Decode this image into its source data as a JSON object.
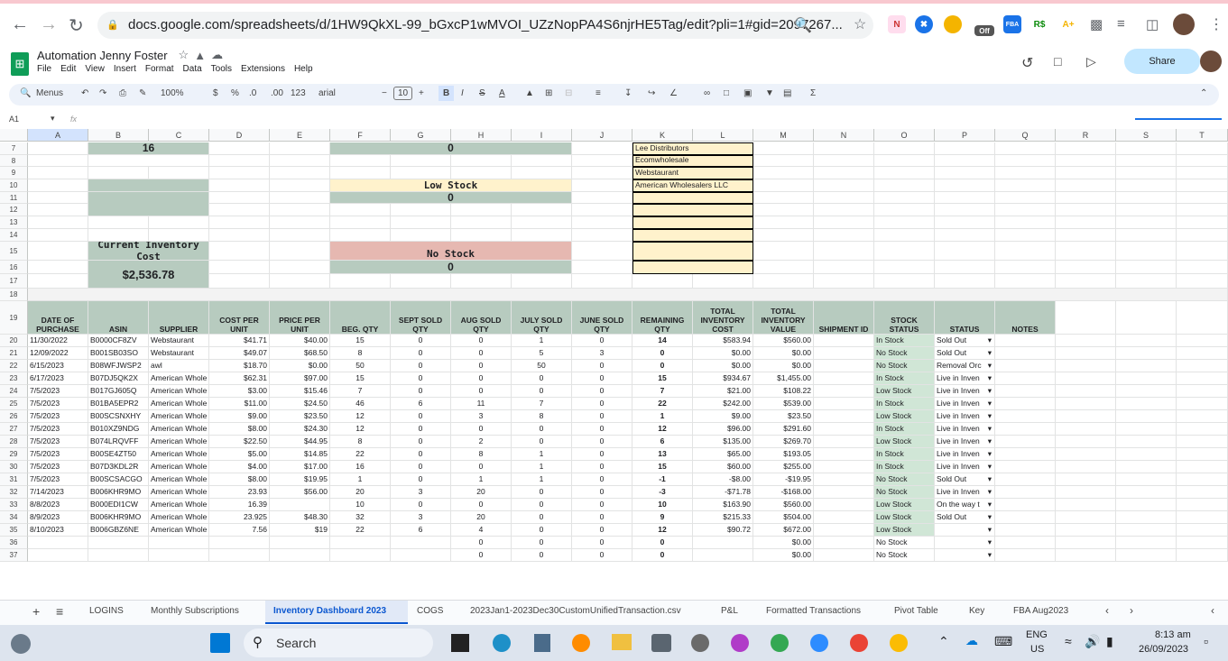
{
  "browser": {
    "url": "docs.google.com/spreadsheets/d/1HW9QkXL-99_bGxcP1wMVOI_UZzNopPA4S6njrHE5Tag/edit?pli=1#gid=2097267...",
    "ext_off": "Off"
  },
  "doc": {
    "title": "Automation Jenny Foster",
    "menus": [
      "File",
      "Edit",
      "View",
      "Insert",
      "Format",
      "Data",
      "Tools",
      "Extensions",
      "Help"
    ],
    "share": "Share"
  },
  "toolbar": {
    "menus": "Menus",
    "zoom": "100%",
    "currency": "$",
    "percent": "%",
    "dec_dec": ".0",
    "dec_inc": ".00",
    "fmt123": "123",
    "font": "arial",
    "size": "10"
  },
  "formula": {
    "cellref": "A1",
    "fx": "fx"
  },
  "columns": [
    "A",
    "B",
    "C",
    "D",
    "E",
    "F",
    "G",
    "H",
    "I",
    "J",
    "K",
    "L",
    "M",
    "N",
    "O",
    "P",
    "Q",
    "R",
    "S",
    "T"
  ],
  "rownums": [
    "7",
    "8",
    "9",
    "10",
    "11",
    "12",
    "13",
    "14",
    "15",
    "16",
    "17",
    "18",
    "19",
    "20",
    "21",
    "22",
    "23",
    "24",
    "25",
    "26",
    "27",
    "28",
    "29",
    "30",
    "31",
    "32",
    "33",
    "34",
    "35",
    "36",
    "37"
  ],
  "dashboard": {
    "val16": "16",
    "val0a": "0",
    "low_stock": "Low Stock",
    "val0b": "0",
    "inv_cost_label": "Current Inventory Cost",
    "inv_cost": "$2,536.78",
    "no_stock": "No Stock",
    "val0c": "0",
    "suppliers": [
      "Lee Distributors",
      "Ecomwholesale",
      "Webstaurant",
      "American Wholesalers LLC"
    ]
  },
  "table": {
    "headers": [
      "DATE OF PURCHASE",
      "ASIN",
      "SUPPLIER",
      "COST PER UNIT",
      "PRICE PER UNIT",
      "BEG. QTY",
      "SEPT SOLD QTY",
      "AUG SOLD QTY",
      "JULY SOLD QTY",
      "JUNE SOLD QTY",
      "REMAINING QTY",
      "TOTAL INVENTORY COST",
      "TOTAL INVENTORY VALUE",
      "SHIPMENT ID",
      "STOCK STATUS",
      "STATUS",
      "NOTES"
    ],
    "rows": [
      [
        "11/30/2022",
        "B0000CF8ZV",
        "Webstaurant",
        "$41.71",
        "$40.00",
        "15",
        "0",
        "0",
        "1",
        "0",
        "14",
        "$583.94",
        "$560.00",
        "",
        "In Stock",
        "Sold Out",
        ""
      ],
      [
        "12/09/2022",
        "B001SB03SO",
        "Webstaurant",
        "$49.07",
        "$68.50",
        "8",
        "0",
        "0",
        "5",
        "3",
        "0",
        "$0.00",
        "$0.00",
        "",
        "No Stock",
        "Sold Out",
        ""
      ],
      [
        "6/15/2023",
        "B08WFJWSP2",
        "awl",
        "$18.70",
        "$0.00",
        "50",
        "0",
        "0",
        "50",
        "0",
        "0",
        "$0.00",
        "$0.00",
        "",
        "No Stock",
        "Removal Orc",
        ""
      ],
      [
        "6/17/2023",
        "B07DJ5QK2X",
        "American Whole",
        "$62.31",
        "$97.00",
        "15",
        "0",
        "0",
        "0",
        "0",
        "15",
        "$934.67",
        "$1,455.00",
        "",
        "In Stock",
        "Live in Inven",
        ""
      ],
      [
        "7/5/2023",
        "B017GJ605Q",
        "American Whole",
        "$3.00",
        "$15.46",
        "7",
        "0",
        "0",
        "0",
        "0",
        "7",
        "$21.00",
        "$108.22",
        "",
        "Low Stock",
        "Live in Inven",
        ""
      ],
      [
        "7/5/2023",
        "B01BA5EPR2",
        "American Whole",
        "$11.00",
        "$24.50",
        "46",
        "6",
        "11",
        "7",
        "0",
        "22",
        "$242.00",
        "$539.00",
        "",
        "In Stock",
        "Live in Inven",
        ""
      ],
      [
        "7/5/2023",
        "B00SCSNXHY",
        "American Whole",
        "$9.00",
        "$23.50",
        "12",
        "0",
        "3",
        "8",
        "0",
        "1",
        "$9.00",
        "$23.50",
        "",
        "Low Stock",
        "Live in Inven",
        ""
      ],
      [
        "7/5/2023",
        "B010XZ9NDG",
        "American Whole",
        "$8.00",
        "$24.30",
        "12",
        "0",
        "0",
        "0",
        "0",
        "12",
        "$96.00",
        "$291.60",
        "",
        "In Stock",
        "Live in Inven",
        ""
      ],
      [
        "7/5/2023",
        "B074LRQVFF",
        "American Whole",
        "$22.50",
        "$44.95",
        "8",
        "0",
        "2",
        "0",
        "0",
        "6",
        "$135.00",
        "$269.70",
        "",
        "Low Stock",
        "Live in Inven",
        ""
      ],
      [
        "7/5/2023",
        "B00SE4ZT50",
        "American Whole",
        "$5.00",
        "$14.85",
        "22",
        "0",
        "8",
        "1",
        "0",
        "13",
        "$65.00",
        "$193.05",
        "",
        "In Stock",
        "Live in Inven",
        ""
      ],
      [
        "7/5/2023",
        "B07D3KDL2R",
        "American Whole",
        "$4.00",
        "$17.00",
        "16",
        "0",
        "0",
        "1",
        "0",
        "15",
        "$60.00",
        "$255.00",
        "",
        "In Stock",
        "Live in Inven",
        ""
      ],
      [
        "7/5/2023",
        "B00SCSACGO",
        "American Whole",
        "$8.00",
        "$19.95",
        "1",
        "0",
        "1",
        "1",
        "0",
        "-1",
        "-$8.00",
        "-$19.95",
        "",
        "No Stock",
        "Sold Out",
        ""
      ],
      [
        "7/14/2023",
        "B006KHR9MO",
        "American Whole",
        "23.93",
        "$56.00",
        "20",
        "3",
        "20",
        "0",
        "0",
        "-3",
        "-$71.78",
        "-$168.00",
        "",
        "No Stock",
        "Live in Inven",
        ""
      ],
      [
        "8/8/2023",
        "B000EDI1CW",
        "American Whole",
        "16.39",
        "",
        "10",
        "0",
        "0",
        "0",
        "0",
        "10",
        "$163.90",
        "$560.00",
        "",
        "Low Stock",
        "On the way t",
        ""
      ],
      [
        "8/9/2023",
        "B006KHR9MO",
        "American Whole",
        "23.925",
        "$48.30",
        "32",
        "3",
        "20",
        "0",
        "0",
        "9",
        "$215.33",
        "$504.00",
        "",
        "Low Stock",
        "Sold Out",
        ""
      ],
      [
        "8/10/2023",
        "B006GBZ6NE",
        "American Whole",
        "7.56",
        "$19",
        "22",
        "6",
        "4",
        "0",
        "0",
        "12",
        "$90.72",
        "$672.00",
        "",
        "Low Stock",
        "",
        ""
      ],
      [
        "",
        "",
        "",
        "",
        "",
        "",
        "",
        "0",
        "0",
        "0",
        "0",
        "",
        "$0.00",
        "",
        "No Stock",
        "",
        ""
      ],
      [
        "",
        "",
        "",
        "",
        "",
        "",
        "",
        "0",
        "0",
        "0",
        "0",
        "",
        "$0.00",
        "",
        "No Stock",
        "",
        ""
      ]
    ]
  },
  "tabs": [
    "LOGINS",
    "Monthly Subscriptions",
    "Inventory Dashboard 2023",
    "COGS",
    "2023Jan1-2023Dec30CustomUnifiedTransaction.csv",
    "P&L",
    "Formatted Transactions",
    "Pivot Table",
    "Key",
    "FBA Aug2023"
  ],
  "taskbar": {
    "search": "Search",
    "lang1": "ENG",
    "lang2": "US",
    "time": "8:13 am",
    "date": "26/09/2023"
  },
  "colors": {
    "green": "#b7cbbf",
    "pink": "#e6b8b1",
    "yellow": "#fff2cc",
    "instock": "#d0e6d6"
  }
}
